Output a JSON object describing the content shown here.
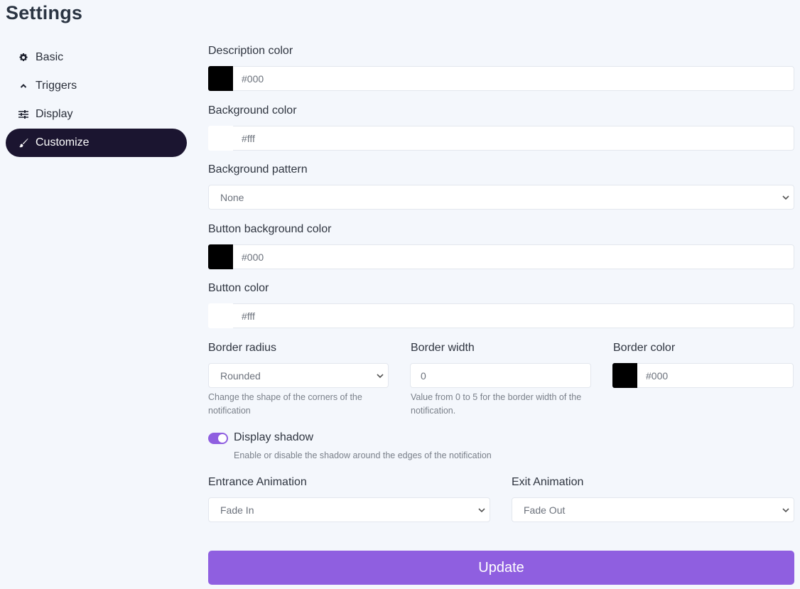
{
  "page": {
    "title": "Settings"
  },
  "sidebar": {
    "items": [
      {
        "label": "Basic",
        "icon": "gear-icon",
        "active": false
      },
      {
        "label": "Triggers",
        "icon": "chevron-up-icon",
        "active": false
      },
      {
        "label": "Display",
        "icon": "sliders-icon",
        "active": false
      },
      {
        "label": "Customize",
        "icon": "paintbrush-icon",
        "active": true
      }
    ]
  },
  "form": {
    "description_color": {
      "label": "Description color",
      "value": "#000",
      "swatch": "#000000"
    },
    "background_color": {
      "label": "Background color",
      "value": "#fff",
      "swatch": "#ffffff"
    },
    "background_pattern": {
      "label": "Background pattern",
      "value": "None"
    },
    "button_background_color": {
      "label": "Button background color",
      "value": "#000",
      "swatch": "#000000"
    },
    "button_color": {
      "label": "Button color",
      "value": "#fff",
      "swatch": "#ffffff"
    },
    "border_radius": {
      "label": "Border radius",
      "value": "Rounded",
      "help": "Change the shape of the corners of the notification"
    },
    "border_width": {
      "label": "Border width",
      "value": "0",
      "help": "Value from 0 to 5 for the border width of the notification."
    },
    "border_color": {
      "label": "Border color",
      "value": "#000",
      "swatch": "#000000"
    },
    "display_shadow": {
      "label": "Display shadow",
      "enabled": true,
      "help": "Enable or disable the shadow around the edges of the notification"
    },
    "entrance_animation": {
      "label": "Entrance Animation",
      "value": "Fade In"
    },
    "exit_animation": {
      "label": "Exit Animation",
      "value": "Fade Out"
    },
    "submit_label": "Update"
  },
  "colors": {
    "accent": "#8f5fe0",
    "nav_active_bg": "#1b1530",
    "page_bg": "#f4f7fc"
  }
}
